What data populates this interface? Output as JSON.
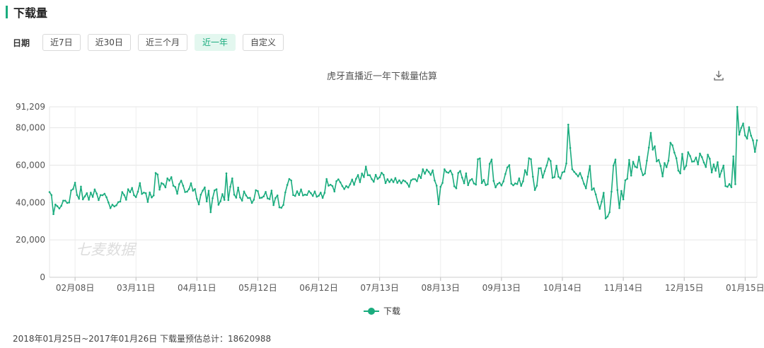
{
  "section": {
    "title": "下载量"
  },
  "date_filter": {
    "label": "日期",
    "options": [
      "近7日",
      "近30日",
      "近三个月",
      "近一年",
      "自定义"
    ],
    "selected": "近一年"
  },
  "footer": {
    "text": "2018年01月25日~2017年01月26日 下载量预估总计：18620988"
  },
  "watermark": "七麦数据",
  "colors": {
    "accent": "#1aac7e",
    "active_bg": "#e3f7ef"
  },
  "chart_data": {
    "type": "line",
    "title": "虎牙直播近一年下载量估算",
    "ylim": [
      0,
      91209
    ],
    "y_ticks": [
      0,
      20000,
      40000,
      60000,
      80000,
      91209
    ],
    "y_tick_labels": [
      "0",
      "20,000",
      "40,000",
      "60,000",
      "80,000",
      "91,209"
    ],
    "x_ticks": [
      "02月08日",
      "03月11日",
      "04月11日",
      "05月12日",
      "06月12日",
      "07月13日",
      "08月13日",
      "09月13日",
      "10月14日",
      "11月14日",
      "12月15日",
      "01月15日"
    ],
    "x_tick_index": [
      13,
      44,
      75,
      106,
      137,
      168,
      199,
      230,
      261,
      292,
      323,
      354
    ],
    "grid": true,
    "legend_position": "bottom",
    "series": [
      {
        "name": "下载",
        "values": [
          45600,
          44000,
          33800,
          38900,
          38000,
          36800,
          38200,
          41000,
          41000,
          39800,
          40000,
          46500,
          47200,
          50600,
          44000,
          42000,
          48500,
          41700,
          43300,
          45000,
          41500,
          45300,
          43000,
          47000,
          44800,
          41300,
          44000,
          43900,
          44700,
          42800,
          40000,
          37000,
          38800,
          37900,
          38500,
          40200,
          40500,
          45600,
          44000,
          41500,
          47100,
          45500,
          47800,
          43900,
          42900,
          45800,
          50400,
          44600,
          45300,
          45000,
          40300,
          45400,
          42700,
          43800,
          55800,
          55000,
          46900,
          50400,
          49800,
          48100,
          52900,
          51700,
          53600,
          49000,
          48300,
          44700,
          49800,
          51700,
          49000,
          45600,
          45800,
          47200,
          50300,
          46300,
          47200,
          42000,
          39000,
          44200,
          46400,
          48100,
          40600,
          46300,
          34800,
          42300,
          46500,
          47100,
          38800,
          40700,
          44500,
          41400,
          55600,
          41300,
          48400,
          52900,
          44200,
          42600,
          48000,
          42700,
          41000,
          45900,
          43800,
          42400,
          42500,
          39800,
          41500,
          46600,
          46100,
          42400,
          42600,
          43300,
          45700,
          42200,
          41800,
          46400,
          38600,
          42400,
          43800,
          37400,
          37200,
          38700,
          45400,
          49400,
          52600,
          51800,
          44000,
          43500,
          46000,
          44000,
          47000,
          43800,
          44200,
          44000,
          46100,
          45000,
          43500,
          45900,
          43100,
          43600,
          45300,
          42500,
          45200,
          52600,
          49000,
          49500,
          48800,
          45900,
          51400,
          52400,
          50800,
          48800,
          47200,
          48800,
          48000,
          49800,
          52300,
          49500,
          52700,
          54700,
          50900,
          55500,
          53600,
          59200,
          54600,
          54600,
          52500,
          51100,
          54800,
          52600,
          53500,
          55900,
          54800,
          50400,
          52500,
          50900,
          52400,
          50900,
          53100,
          50500,
          51900,
          50300,
          51900,
          51300,
          50300,
          48400,
          51900,
          52500,
          52500,
          51400,
          54700,
          53100,
          57800,
          55400,
          57600,
          56400,
          54800,
          57200,
          51800,
          49000,
          39100,
          48400,
          50500,
          57800,
          56300,
          55900,
          57100,
          55000,
          48700,
          47600,
          55800,
          56900,
          53300,
          50300,
          55600,
          49300,
          51900,
          52600,
          50200,
          49600,
          63200,
          63600,
          50400,
          52100,
          49300,
          49800,
          60700,
          63000,
          51600,
          48100,
          49900,
          50600,
          49100,
          51300,
          55300,
          58800,
          60000,
          50100,
          49200,
          50200,
          49900,
          52900,
          48900,
          51400,
          57300,
          54900,
          63700,
          63200,
          53800,
          46700,
          49000,
          58300,
          58400,
          53300,
          56800,
          59800,
          63600,
          62200,
          53200,
          53600,
          59700,
          53800,
          52800,
          56100,
          56500,
          60900,
          81700,
          69200,
          57800,
          56400,
          55300,
          54000,
          55800,
          53100,
          50000,
          47600,
          53800,
          59600,
          46800,
          47600,
          44300,
          40100,
          36600,
          40500,
          45200,
          31500,
          32500,
          34800,
          45800,
          59800,
          63000,
          46700,
          37000,
          46200,
          41700,
          51900,
          52700,
          62800,
          54400,
          61800,
          59200,
          58700,
          64500,
          57900,
          54600,
          55500,
          62400,
          69400,
          77300,
          68300,
          70100,
          62000,
          62800,
          59600,
          54000,
          61100,
          58900,
          62400,
          72000,
          70600,
          66700,
          63700,
          57100,
          55600,
          66000,
          57800,
          59700,
          66900,
          64900,
          61900,
          62000,
          64100,
          60400,
          66200,
          64300,
          61400,
          59000,
          65600,
          63400,
          56100,
          60400,
          57000,
          61600,
          53700,
          56900,
          59800,
          48800,
          48400,
          49900,
          48200,
          64700,
          49800,
          91200,
          76300,
          79900,
          82300,
          75900,
          74200,
          80300,
          75800,
          73200,
          67100,
          73300
        ]
      }
    ]
  }
}
